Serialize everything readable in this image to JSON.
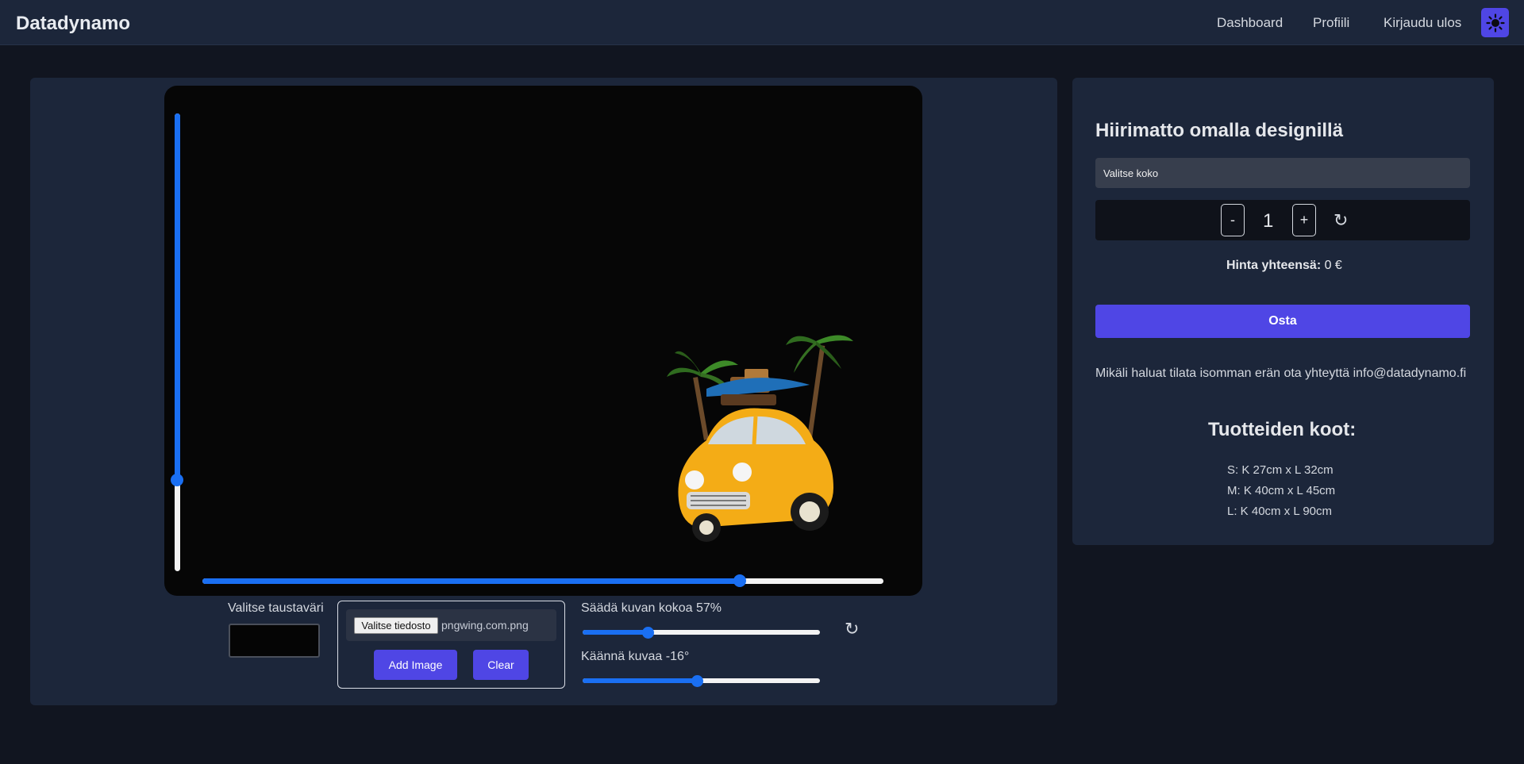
{
  "navbar": {
    "brand": "Datadynamo",
    "links": [
      "Dashboard",
      "Profiili",
      "Kirjaudu ulos"
    ],
    "theme_icon": "sun-icon"
  },
  "editor": {
    "background_label": "Valitse taustaväri",
    "background_color": "#050505",
    "file_button": "Valitse tiedosto",
    "file_name": "pngwing.com.png",
    "add_image": "Add Image",
    "clear": "Clear",
    "size_label": "Säädä kuvan kokoa 57%",
    "size_value": 0.27,
    "rotate_label": "Käännä kuvaa -16°",
    "rotate_value": 0.48,
    "reset_icon": "↻",
    "vertical_position": 0.8,
    "horizontal_position": 0.79,
    "image_icon": "car-with-luggage-image"
  },
  "order": {
    "title": "Hiirimatto omalla designillä",
    "size_select": "Valitse koko",
    "qty_minus": "-",
    "qty_value": "1",
    "qty_plus": "+",
    "qty_reset": "↻",
    "price_label": "Hinta yhteensä:",
    "price_value": " 0 €",
    "buy": "Osta",
    "contact": "Mikäli haluat tilata isomman erän ota yhteyttä info@datadynamo.fi",
    "sizes_title": "Tuotteiden koot:",
    "sizes": [
      "S: K 27cm x L 32cm",
      "M: K 40cm x L 45cm",
      "L: K 40cm x L 90cm"
    ]
  },
  "colors": {
    "accent": "#4f46e5",
    "slider": "#1a6ff2",
    "panel": "#1c263a",
    "page": "#111520"
  }
}
